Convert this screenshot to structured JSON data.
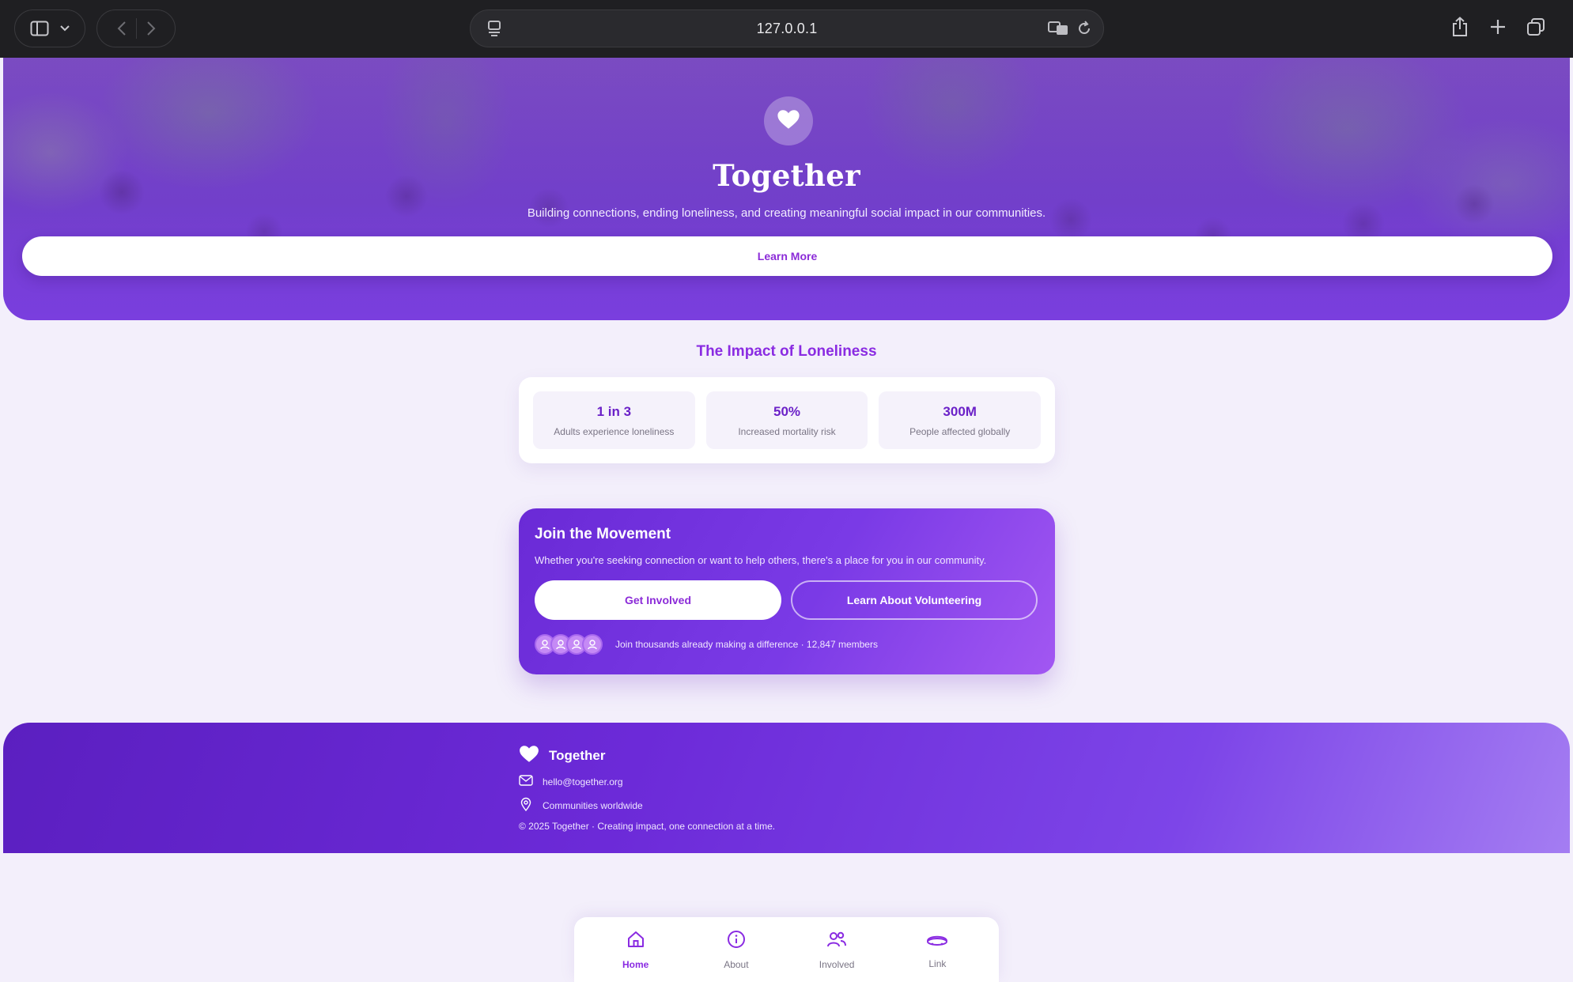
{
  "browser": {
    "url": "127.0.0.1"
  },
  "hero": {
    "title": "Together",
    "subtitle": "Building connections, ending loneliness, and creating meaningful social impact in our communities.",
    "cta_label": "Learn More"
  },
  "impact": {
    "title": "The Impact of Loneliness",
    "stats": [
      {
        "value": "1 in 3",
        "label": "Adults experience loneliness"
      },
      {
        "value": "50%",
        "label": "Increased mortality risk"
      },
      {
        "value": "300M",
        "label": "People affected globally"
      }
    ]
  },
  "join": {
    "title": "Join the Movement",
    "text": "Whether you're seeking connection or want to help others, there's a place for you in our community.",
    "primary_label": "Get Involved",
    "secondary_label": "Learn About Volunteering",
    "members_text": "Join thousands already making a difference · 12,847 members"
  },
  "footer": {
    "brand": "Together",
    "email": "hello@together.org",
    "location": "Communities worldwide",
    "copyright": "© 2025 Together · Creating impact, one connection at a time."
  },
  "bottom_nav": {
    "items": [
      {
        "label": "Home",
        "icon": "home-icon",
        "active": true
      },
      {
        "label": "About",
        "icon": "info-icon",
        "active": false
      },
      {
        "label": "Involved",
        "icon": "users-icon",
        "active": false
      },
      {
        "label": "Link",
        "icon": "link-icon",
        "active": false
      }
    ]
  },
  "colors": {
    "accent": "#8a2be2",
    "hero_purple": "#6e3fc4",
    "page_background": "#f3effb"
  }
}
